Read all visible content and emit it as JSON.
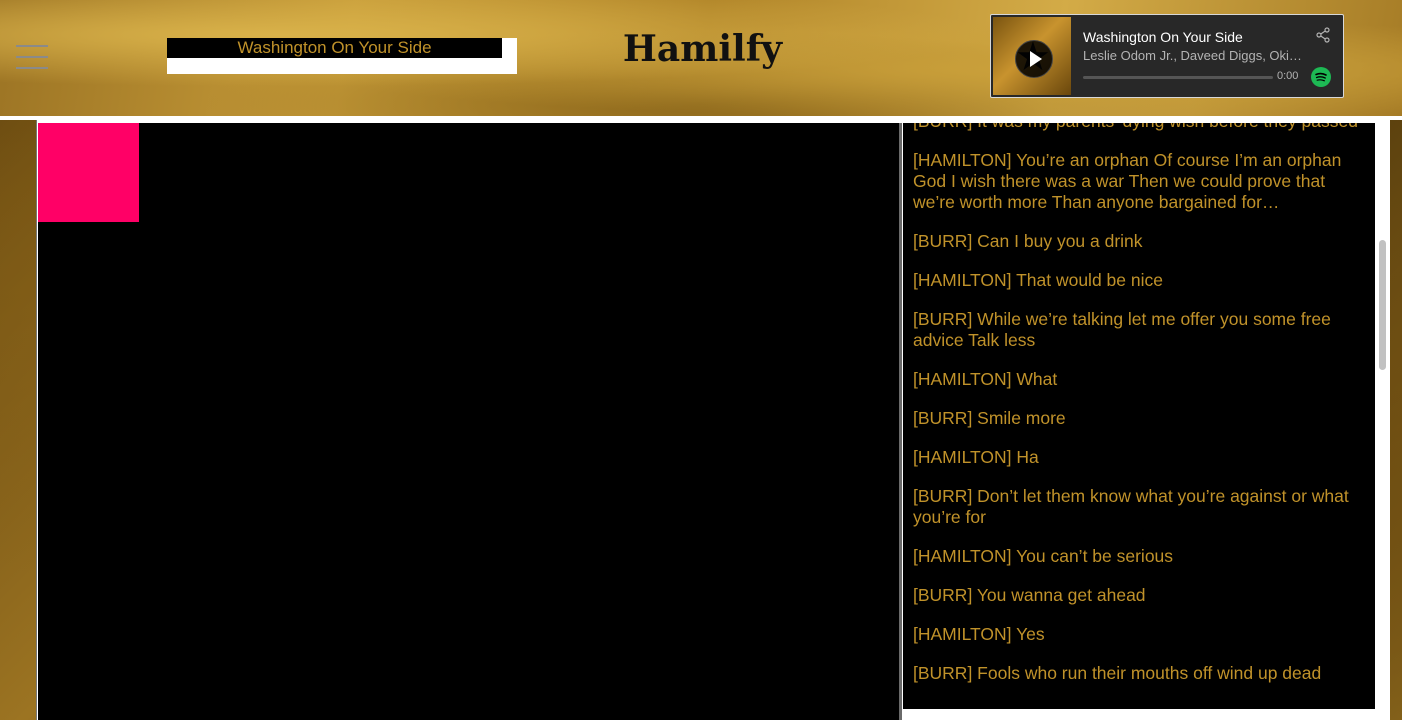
{
  "header": {
    "site_title": "Hamilfy",
    "menu_icon": "hamburger-menu-icon",
    "selected_song": "Washington On Your Side"
  },
  "player": {
    "track_name": "Washington On Your Side",
    "artists": "Leslie Odom Jr., Daveed Diggs, Okieriete Onaodowan, Anthony Ramos, Lin-Manuel Miranda",
    "elapsed": "0:00",
    "progress": 0,
    "play_icon": "play-icon",
    "share_icon": "share-icon",
    "brand_icon": "spotify-icon"
  },
  "colors": {
    "lyric_text": "#c0922a",
    "visualizer_block": "#ff0066",
    "spotify_green": "#1db954"
  },
  "lyrics": [
    "[BURR] It was my parents' dying wish before they passed",
    "[HAMILTON] You’re an orphan Of course I’m an orphan God I wish there was a war Then we could prove that we’re worth more Than anyone bargained for…",
    "[BURR] Can I buy you a drink",
    "[HAMILTON] That would be nice",
    "[BURR] While we’re talking let me offer you some free advice Talk less",
    "[HAMILTON] What",
    "[BURR] Smile more",
    "[HAMILTON] Ha",
    "[BURR] Don’t let them know what you’re against or what you’re for",
    "[HAMILTON] You can’t be serious",
    "[BURR] You wanna get ahead",
    "[HAMILTON] Yes",
    "[BURR] Fools who run their mouths off wind up dead"
  ]
}
